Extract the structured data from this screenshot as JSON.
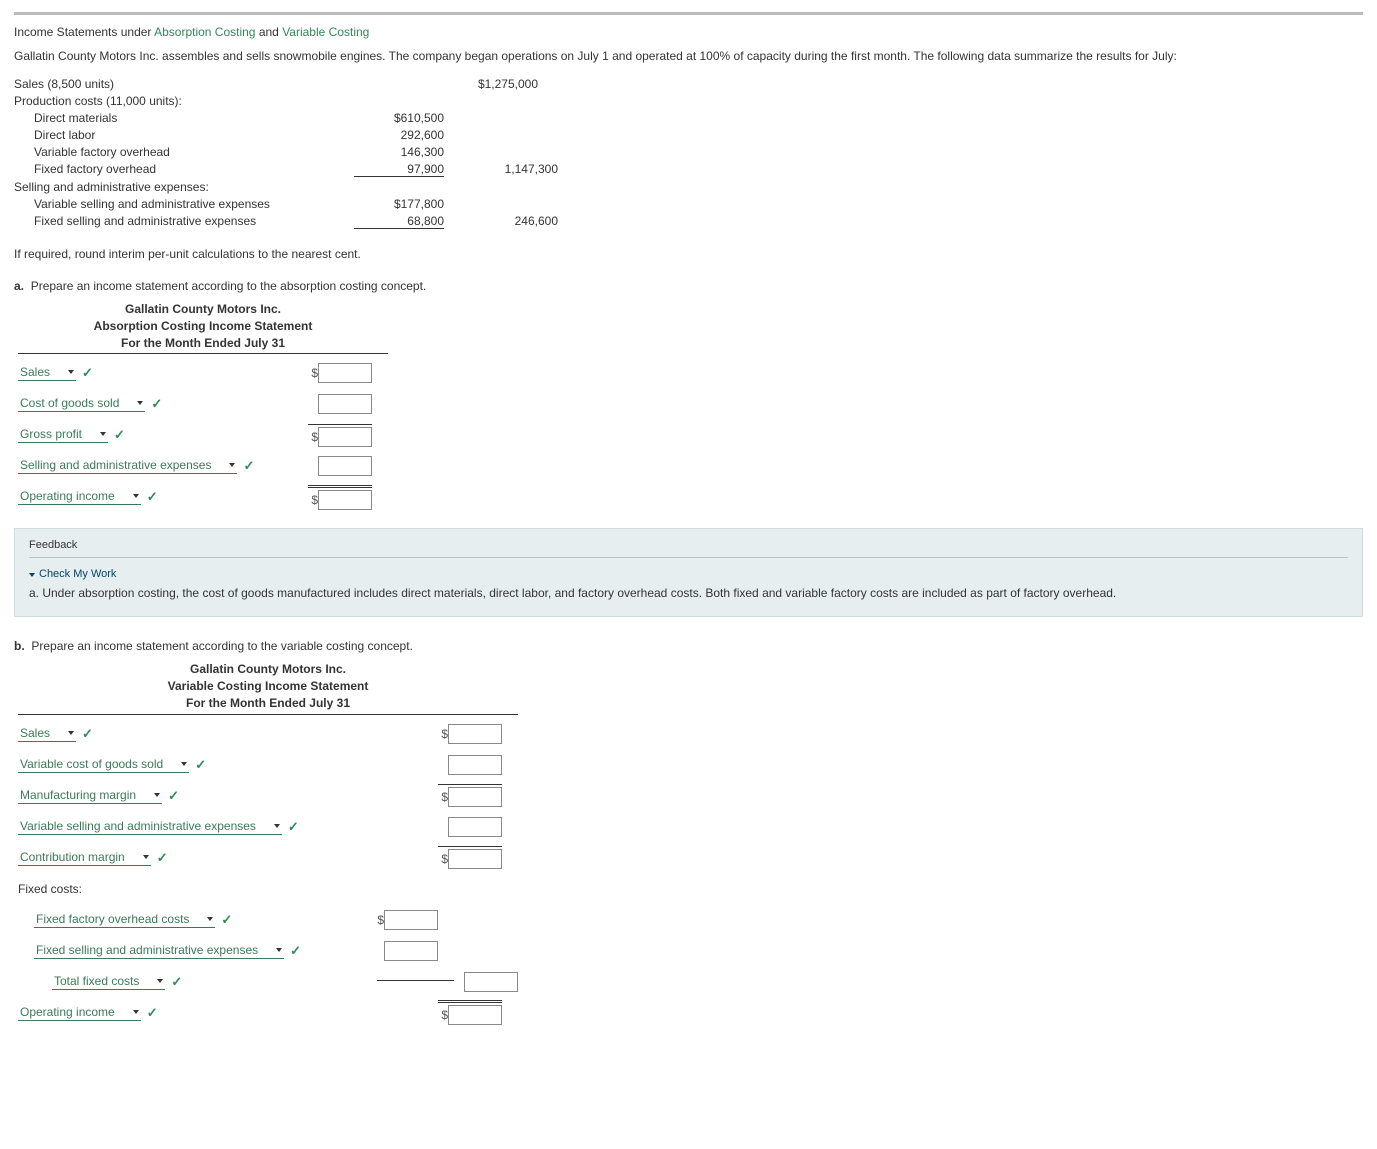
{
  "title": {
    "prefix": "Income Statements under ",
    "l1": "Absorption Costing",
    "mid": " and ",
    "l2": "Variable Costing"
  },
  "problem_text": "Gallatin County Motors Inc. assembles and sells snowmobile engines. The company began operations on July 1 and operated at 100% of capacity during the first month. The following data summarize the results for July:",
  "data": {
    "sales_label": "Sales (8,500 units)",
    "sales_amt": "$1,275,000",
    "prod_label": "Production costs (11,000 units):",
    "dm_l": "Direct materials",
    "dm_v": "$610,500",
    "dl_l": "Direct labor",
    "dl_v": "292,600",
    "vfo_l": "Variable factory overhead",
    "vfo_v": "146,300",
    "ffo_l": "Fixed factory overhead",
    "ffo_v": "97,900",
    "prod_total": "1,147,300",
    "sa_label": "Selling and administrative expenses:",
    "vsa_l": "Variable selling and administrative expenses",
    "vsa_v": "$177,800",
    "fsa_l": "Fixed selling and administrative expenses",
    "fsa_v": "68,800",
    "sa_total": "246,600"
  },
  "round_note": "If required, round interim per-unit calculations to the nearest cent.",
  "partA": {
    "prompt": "Prepare an income statement according to the absorption costing concept.",
    "h1": "Gallatin County Motors Inc.",
    "h2": "Absorption Costing Income Statement",
    "h3": "For the Month Ended July 31",
    "rows": [
      "Sales",
      "Cost of goods sold",
      "Gross profit",
      "Selling and administrative expenses",
      "Operating income"
    ]
  },
  "feedback": {
    "heading": "Feedback",
    "cmw": "Check My Work",
    "text": "a. Under absorption costing, the cost of goods manufactured includes direct materials, direct labor, and factory overhead costs. Both fixed and variable factory costs are included as part of factory overhead."
  },
  "partB": {
    "prompt": "Prepare an income statement according to the variable costing concept.",
    "h1": "Gallatin County Motors Inc.",
    "h2": "Variable Costing Income Statement",
    "h3": "For the Month Ended July 31",
    "rows": {
      "sales": "Sales",
      "vcogs": "Variable cost of goods sold",
      "mm": "Manufacturing margin",
      "vsae": "Variable selling and administrative expenses",
      "cm": "Contribution margin",
      "fc_label": "Fixed costs:",
      "ffoc": "Fixed factory overhead costs",
      "fsae": "Fixed selling and administrative expenses",
      "tfc": "Total fixed costs",
      "oi": "Operating income"
    }
  }
}
